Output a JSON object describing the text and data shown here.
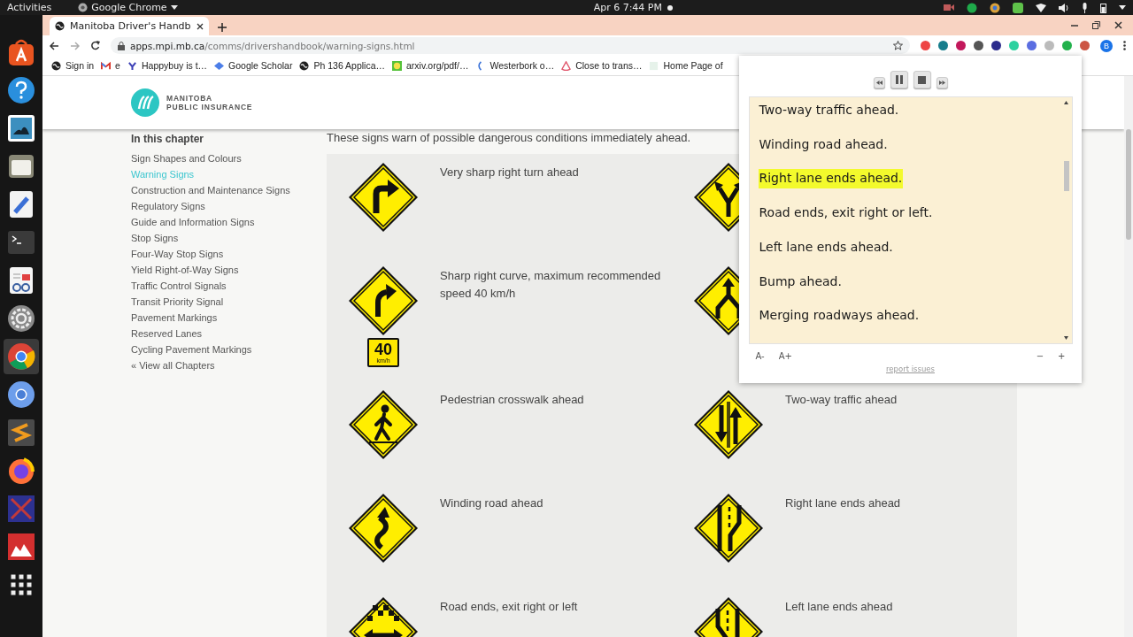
{
  "topbar": {
    "activities": "Activities",
    "app_menu": "Google Chrome",
    "clock": "Apr 6  7:44 PM"
  },
  "browser": {
    "tab": {
      "title": "Manitoba Driver's Handb"
    },
    "address": {
      "host": "apps.mpi.mb.ca",
      "path": "/comms/drivershandbook/warning-signs.html"
    },
    "profile": "B",
    "bookmarks": [
      {
        "label": "Sign in"
      },
      {
        "label": "e"
      },
      {
        "label": "Happybuy is t…"
      },
      {
        "label": "Google Scholar"
      },
      {
        "label": "Ph 136 Applica…"
      },
      {
        "label": "arxiv.org/pdf/…"
      },
      {
        "label": "Westerbork o…"
      },
      {
        "label": "Close to trans…"
      },
      {
        "label": "Home Page of"
      }
    ]
  },
  "page": {
    "logo": {
      "line_1": "MANITOBA",
      "line_2": "PUBLIC INSURANCE"
    },
    "sidebar": {
      "heading": "In this chapter",
      "items": [
        {
          "label": "Sign Shapes and Colours",
          "selected": false
        },
        {
          "label": "Warning Signs",
          "selected": true
        },
        {
          "label": "Construction and Maintenance Signs",
          "selected": false
        },
        {
          "label": "Regulatory Signs",
          "selected": false
        },
        {
          "label": "Guide and Information Signs",
          "selected": false
        },
        {
          "label": "Stop Signs",
          "selected": false
        },
        {
          "label": "Four-Way Stop Signs",
          "selected": false
        },
        {
          "label": "Yield Right-of-Way Signs",
          "selected": false
        },
        {
          "label": "Traffic Control Signals",
          "selected": false
        },
        {
          "label": "Transit Priority Signal",
          "selected": false
        },
        {
          "label": "Pavement Markings",
          "selected": false
        },
        {
          "label": "Reserved Lanes",
          "selected": false
        },
        {
          "label": "Cycling Pavement Markings",
          "selected": false
        }
      ],
      "all_chapters": "« View all Chapters"
    },
    "intro": "These signs warn of possible dangerous conditions immediately ahead.",
    "signs": [
      {
        "kind": "turn-right",
        "label": "Very sharp right turn ahead"
      },
      {
        "kind": "divide"
      },
      {
        "kind": "curve-right",
        "label": "Sharp right curve, maximum recommended speed 40 km/h",
        "plate": {
          "speed": "40",
          "unit": "km/h"
        }
      },
      {
        "kind": "merge"
      },
      {
        "kind": "pedestrian",
        "label": "Pedestrian crosswalk ahead"
      },
      {
        "kind": "two-way",
        "label": "Two-way traffic ahead"
      },
      {
        "kind": "winding",
        "label": "Winding road ahead"
      },
      {
        "kind": "right-lane-ends",
        "label": "Right lane ends ahead"
      },
      {
        "kind": "road-ends",
        "label": "Road ends, exit right or left"
      },
      {
        "kind": "left-lane-ends",
        "label": "Left lane ends ahead"
      }
    ]
  },
  "reader": {
    "sentences": [
      {
        "text": "Two-way traffic ahead.",
        "selected": false
      },
      {
        "text": "Winding road ahead.",
        "selected": false
      },
      {
        "text": "Right lane ends ahead.",
        "selected": true
      },
      {
        "text": "Road ends, exit right or left.",
        "selected": false
      },
      {
        "text": "Left lane ends ahead.",
        "selected": false
      },
      {
        "text": "Bump ahead.",
        "selected": false
      },
      {
        "text": "Merging roadways ahead.",
        "selected": false
      }
    ],
    "font_smaller": "A-",
    "font_larger": "A+",
    "speed_down": "−",
    "speed_up": "+",
    "report": "report issues"
  }
}
